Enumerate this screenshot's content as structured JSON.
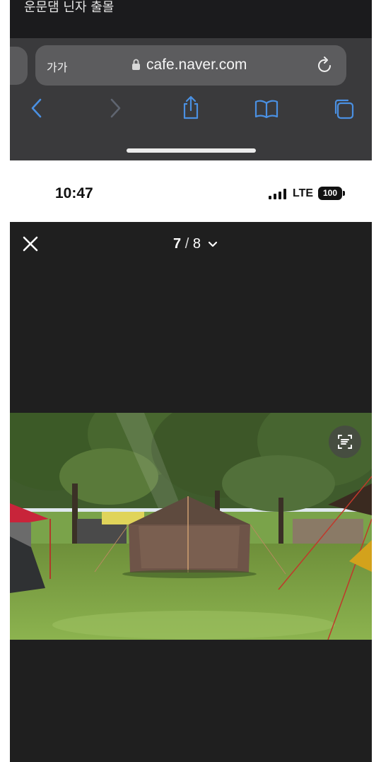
{
  "browser": {
    "page_title": "운문댐 닌자 출몰",
    "text_size_label": "가가",
    "url": "cafe.naver.com",
    "icons": [
      "lock-icon",
      "reload-icon",
      "back-icon",
      "forward-icon",
      "share-icon",
      "bookmarks-icon",
      "tabs-icon"
    ]
  },
  "status_bar": {
    "time": "10:47",
    "network": "LTE",
    "battery": "100"
  },
  "viewer": {
    "current": "7",
    "separator": "/",
    "total": "8",
    "icons": [
      "close-icon",
      "chevron-down-icon",
      "live-text-icon"
    ]
  },
  "photo": {
    "description_icon": "camping-photo"
  },
  "colors": {
    "toolbar": "#3a3a3c",
    "accent_blue": "#4a90e2",
    "viewer_bg": "#1f1f1f"
  }
}
